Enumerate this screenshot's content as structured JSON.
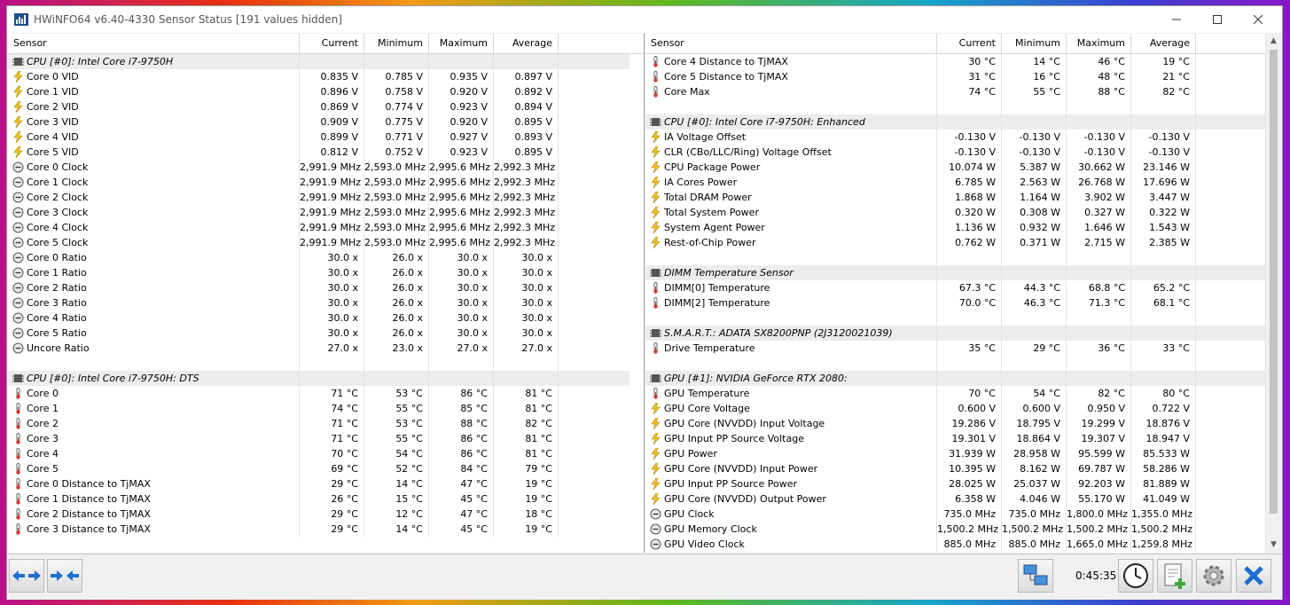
{
  "window": {
    "title": "HWiNFO64 v6.40-4330 Sensor Status [191 values hidden]"
  },
  "columns": {
    "sensor": "Sensor",
    "current": "Current",
    "minimum": "Minimum",
    "maximum": "Maximum",
    "average": "Average"
  },
  "left_rows": [
    {
      "type": "group",
      "icon": "chip-icon",
      "name": "CPU [#0]: Intel Core i7-9750H"
    },
    {
      "type": "sensor",
      "icon": "voltage-icon",
      "name": "Core 0 VID",
      "cur": "0.835 V",
      "min": "0.785 V",
      "max": "0.935 V",
      "avg": "0.897 V"
    },
    {
      "type": "sensor",
      "icon": "voltage-icon",
      "name": "Core 1 VID",
      "cur": "0.896 V",
      "min": "0.758 V",
      "max": "0.920 V",
      "avg": "0.892 V"
    },
    {
      "type": "sensor",
      "icon": "voltage-icon",
      "name": "Core 2 VID",
      "cur": "0.869 V",
      "min": "0.774 V",
      "max": "0.923 V",
      "avg": "0.894 V"
    },
    {
      "type": "sensor",
      "icon": "voltage-icon",
      "name": "Core 3 VID",
      "cur": "0.909 V",
      "min": "0.775 V",
      "max": "0.920 V",
      "avg": "0.895 V"
    },
    {
      "type": "sensor",
      "icon": "voltage-icon",
      "name": "Core 4 VID",
      "cur": "0.899 V",
      "min": "0.771 V",
      "max": "0.927 V",
      "avg": "0.893 V"
    },
    {
      "type": "sensor",
      "icon": "voltage-icon",
      "name": "Core 5 VID",
      "cur": "0.812 V",
      "min": "0.752 V",
      "max": "0.923 V",
      "avg": "0.895 V"
    },
    {
      "type": "sensor",
      "icon": "clock-icon",
      "name": "Core 0 Clock",
      "cur": "2,991.9 MHz",
      "min": "2,593.0 MHz",
      "max": "2,995.6 MHz",
      "avg": "2,992.3 MHz"
    },
    {
      "type": "sensor",
      "icon": "clock-icon",
      "name": "Core 1 Clock",
      "cur": "2,991.9 MHz",
      "min": "2,593.0 MHz",
      "max": "2,995.6 MHz",
      "avg": "2,992.3 MHz"
    },
    {
      "type": "sensor",
      "icon": "clock-icon",
      "name": "Core 2 Clock",
      "cur": "2,991.9 MHz",
      "min": "2,593.0 MHz",
      "max": "2,995.6 MHz",
      "avg": "2,992.3 MHz"
    },
    {
      "type": "sensor",
      "icon": "clock-icon",
      "name": "Core 3 Clock",
      "cur": "2,991.9 MHz",
      "min": "2,593.0 MHz",
      "max": "2,995.6 MHz",
      "avg": "2,992.3 MHz"
    },
    {
      "type": "sensor",
      "icon": "clock-icon",
      "name": "Core 4 Clock",
      "cur": "2,991.9 MHz",
      "min": "2,593.0 MHz",
      "max": "2,995.6 MHz",
      "avg": "2,992.3 MHz"
    },
    {
      "type": "sensor",
      "icon": "clock-icon",
      "name": "Core 5 Clock",
      "cur": "2,991.9 MHz",
      "min": "2,593.0 MHz",
      "max": "2,995.6 MHz",
      "avg": "2,992.3 MHz"
    },
    {
      "type": "sensor",
      "icon": "clock-icon",
      "name": "Core 0 Ratio",
      "cur": "30.0 x",
      "min": "26.0 x",
      "max": "30.0 x",
      "avg": "30.0 x"
    },
    {
      "type": "sensor",
      "icon": "clock-icon",
      "name": "Core 1 Ratio",
      "cur": "30.0 x",
      "min": "26.0 x",
      "max": "30.0 x",
      "avg": "30.0 x"
    },
    {
      "type": "sensor",
      "icon": "clock-icon",
      "name": "Core 2 Ratio",
      "cur": "30.0 x",
      "min": "26.0 x",
      "max": "30.0 x",
      "avg": "30.0 x"
    },
    {
      "type": "sensor",
      "icon": "clock-icon",
      "name": "Core 3 Ratio",
      "cur": "30.0 x",
      "min": "26.0 x",
      "max": "30.0 x",
      "avg": "30.0 x"
    },
    {
      "type": "sensor",
      "icon": "clock-icon",
      "name": "Core 4 Ratio",
      "cur": "30.0 x",
      "min": "26.0 x",
      "max": "30.0 x",
      "avg": "30.0 x"
    },
    {
      "type": "sensor",
      "icon": "clock-icon",
      "name": "Core 5 Ratio",
      "cur": "30.0 x",
      "min": "26.0 x",
      "max": "30.0 x",
      "avg": "30.0 x"
    },
    {
      "type": "sensor",
      "icon": "clock-icon",
      "name": "Uncore Ratio",
      "cur": "27.0 x",
      "min": "23.0 x",
      "max": "27.0 x",
      "avg": "27.0 x"
    },
    {
      "type": "blank"
    },
    {
      "type": "group",
      "icon": "chip-icon",
      "name": "CPU [#0]: Intel Core i7-9750H: DTS"
    },
    {
      "type": "sensor",
      "icon": "thermometer-icon",
      "name": "Core 0",
      "cur": "71 °C",
      "min": "53 °C",
      "max": "86 °C",
      "avg": "81 °C"
    },
    {
      "type": "sensor",
      "icon": "thermometer-icon",
      "name": "Core 1",
      "cur": "74 °C",
      "min": "55 °C",
      "max": "85 °C",
      "avg": "81 °C"
    },
    {
      "type": "sensor",
      "icon": "thermometer-icon",
      "name": "Core 2",
      "cur": "71 °C",
      "min": "53 °C",
      "max": "88 °C",
      "avg": "82 °C"
    },
    {
      "type": "sensor",
      "icon": "thermometer-icon",
      "name": "Core 3",
      "cur": "71 °C",
      "min": "55 °C",
      "max": "86 °C",
      "avg": "81 °C"
    },
    {
      "type": "sensor",
      "icon": "thermometer-icon",
      "name": "Core 4",
      "cur": "70 °C",
      "min": "54 °C",
      "max": "86 °C",
      "avg": "81 °C"
    },
    {
      "type": "sensor",
      "icon": "thermometer-icon",
      "name": "Core 5",
      "cur": "69 °C",
      "min": "52 °C",
      "max": "84 °C",
      "avg": "79 °C"
    },
    {
      "type": "sensor",
      "icon": "thermometer-icon",
      "name": "Core 0 Distance to TjMAX",
      "cur": "29 °C",
      "min": "14 °C",
      "max": "47 °C",
      "avg": "19 °C"
    },
    {
      "type": "sensor",
      "icon": "thermometer-icon",
      "name": "Core 1 Distance to TjMAX",
      "cur": "26 °C",
      "min": "15 °C",
      "max": "45 °C",
      "avg": "19 °C"
    },
    {
      "type": "sensor",
      "icon": "thermometer-icon",
      "name": "Core 2 Distance to TjMAX",
      "cur": "29 °C",
      "min": "12 °C",
      "max": "47 °C",
      "avg": "18 °C"
    },
    {
      "type": "sensor",
      "icon": "thermometer-icon",
      "name": "Core 3 Distance to TjMAX",
      "cur": "29 °C",
      "min": "14 °C",
      "max": "45 °C",
      "avg": "19 °C"
    }
  ],
  "right_rows": [
    {
      "type": "sensor",
      "icon": "thermometer-icon",
      "name": "Core 4 Distance to TjMAX",
      "cur": "30 °C",
      "min": "14 °C",
      "max": "46 °C",
      "avg": "19 °C"
    },
    {
      "type": "sensor",
      "icon": "thermometer-icon",
      "name": "Core 5 Distance to TjMAX",
      "cur": "31 °C",
      "min": "16 °C",
      "max": "48 °C",
      "avg": "21 °C"
    },
    {
      "type": "sensor",
      "icon": "thermometer-icon",
      "name": "Core Max",
      "cur": "74 °C",
      "min": "55 °C",
      "max": "88 °C",
      "avg": "82 °C"
    },
    {
      "type": "blank"
    },
    {
      "type": "group",
      "icon": "chip-icon",
      "name": "CPU [#0]: Intel Core i7-9750H: Enhanced"
    },
    {
      "type": "sensor",
      "icon": "voltage-icon",
      "name": "IA Voltage Offset",
      "cur": "-0.130 V",
      "min": "-0.130 V",
      "max": "-0.130 V",
      "avg": "-0.130 V"
    },
    {
      "type": "sensor",
      "icon": "voltage-icon",
      "name": "CLR (CBo/LLC/Ring) Voltage Offset",
      "cur": "-0.130 V",
      "min": "-0.130 V",
      "max": "-0.130 V",
      "avg": "-0.130 V"
    },
    {
      "type": "sensor",
      "icon": "voltage-icon",
      "name": "CPU Package Power",
      "cur": "10.074 W",
      "min": "5.387 W",
      "max": "30.662 W",
      "avg": "23.146 W"
    },
    {
      "type": "sensor",
      "icon": "voltage-icon",
      "name": "IA Cores Power",
      "cur": "6.785 W",
      "min": "2.563 W",
      "max": "26.768 W",
      "avg": "17.696 W"
    },
    {
      "type": "sensor",
      "icon": "voltage-icon",
      "name": "Total DRAM Power",
      "cur": "1.868 W",
      "min": "1.164 W",
      "max": "3.902 W",
      "avg": "3.447 W"
    },
    {
      "type": "sensor",
      "icon": "voltage-icon",
      "name": "Total System Power",
      "cur": "0.320 W",
      "min": "0.308 W",
      "max": "0.327 W",
      "avg": "0.322 W"
    },
    {
      "type": "sensor",
      "icon": "voltage-icon",
      "name": "System Agent Power",
      "cur": "1.136 W",
      "min": "0.932 W",
      "max": "1.646 W",
      "avg": "1.543 W"
    },
    {
      "type": "sensor",
      "icon": "voltage-icon",
      "name": "Rest-of-Chip Power",
      "cur": "0.762 W",
      "min": "0.371 W",
      "max": "2.715 W",
      "avg": "2.385 W"
    },
    {
      "type": "blank"
    },
    {
      "type": "group",
      "icon": "chip-icon",
      "name": "DIMM Temperature Sensor"
    },
    {
      "type": "sensor",
      "icon": "thermometer-icon",
      "name": "DIMM[0] Temperature",
      "cur": "67.3 °C",
      "min": "44.3 °C",
      "max": "68.8 °C",
      "avg": "65.2 °C"
    },
    {
      "type": "sensor",
      "icon": "thermometer-icon",
      "name": "DIMM[2] Temperature",
      "cur": "70.0 °C",
      "min": "46.3 °C",
      "max": "71.3 °C",
      "avg": "68.1 °C"
    },
    {
      "type": "blank"
    },
    {
      "type": "group",
      "icon": "chip-icon",
      "name": "S.M.A.R.T.: ADATA SX8200PNP (2J3120021039)"
    },
    {
      "type": "sensor",
      "icon": "thermometer-icon",
      "name": "Drive Temperature",
      "cur": "35 °C",
      "min": "29 °C",
      "max": "36 °C",
      "avg": "33 °C"
    },
    {
      "type": "blank"
    },
    {
      "type": "group",
      "icon": "chip-icon",
      "name": "GPU [#1]: NVIDIA GeForce RTX 2080:"
    },
    {
      "type": "sensor",
      "icon": "thermometer-icon",
      "name": "GPU Temperature",
      "cur": "70 °C",
      "min": "54 °C",
      "max": "82 °C",
      "avg": "80 °C"
    },
    {
      "type": "sensor",
      "icon": "voltage-icon",
      "name": "GPU Core Voltage",
      "cur": "0.600 V",
      "min": "0.600 V",
      "max": "0.950 V",
      "avg": "0.722 V"
    },
    {
      "type": "sensor",
      "icon": "voltage-icon",
      "name": "GPU Core (NVVDD) Input Voltage",
      "cur": "19.286 V",
      "min": "18.795 V",
      "max": "19.299 V",
      "avg": "18.876 V"
    },
    {
      "type": "sensor",
      "icon": "voltage-icon",
      "name": "GPU Input PP Source Voltage",
      "cur": "19.301 V",
      "min": "18.864 V",
      "max": "19.307 V",
      "avg": "18.947 V"
    },
    {
      "type": "sensor",
      "icon": "voltage-icon",
      "name": "GPU Power",
      "cur": "31.939 W",
      "min": "28.958 W",
      "max": "95.599 W",
      "avg": "85.533 W"
    },
    {
      "type": "sensor",
      "icon": "voltage-icon",
      "name": "GPU Core (NVVDD) Input Power",
      "cur": "10.395 W",
      "min": "8.162 W",
      "max": "69.787 W",
      "avg": "58.286 W"
    },
    {
      "type": "sensor",
      "icon": "voltage-icon",
      "name": "GPU Input PP Source Power",
      "cur": "28.025 W",
      "min": "25.037 W",
      "max": "92.203 W",
      "avg": "81.889 W"
    },
    {
      "type": "sensor",
      "icon": "voltage-icon",
      "name": "GPU Core (NVVDD) Output Power",
      "cur": "6.358 W",
      "min": "4.046 W",
      "max": "55.170 W",
      "avg": "41.049 W"
    },
    {
      "type": "sensor",
      "icon": "clock-icon",
      "name": "GPU Clock",
      "cur": "735.0 MHz",
      "min": "735.0 MHz",
      "max": "1,800.0 MHz",
      "avg": "1,355.0 MHz"
    },
    {
      "type": "sensor",
      "icon": "clock-icon",
      "name": "GPU Memory Clock",
      "cur": "1,500.2 MHz",
      "min": "1,500.2 MHz",
      "max": "1,500.2 MHz",
      "avg": "1,500.2 MHz"
    },
    {
      "type": "sensor",
      "icon": "clock-icon",
      "name": "GPU Video Clock",
      "cur": "885.0 MHz",
      "min": "885.0 MHz",
      "max": "1,665.0 MHz",
      "avg": "1,259.8 MHz"
    }
  ],
  "toolbar": {
    "elapsed_time": "0:45:35"
  }
}
